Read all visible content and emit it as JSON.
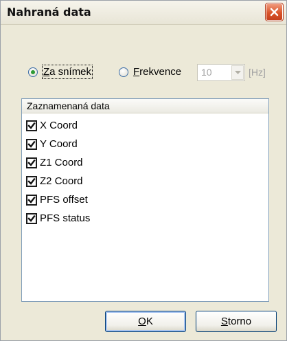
{
  "window": {
    "title": "Nahraná data"
  },
  "mode": {
    "per_frame_label_underlined": "Z",
    "per_frame_label_rest": "a snímek",
    "per_frame_selected": true,
    "frequency_label_underlined": "F",
    "frequency_label_rest": "rekvence",
    "frequency_selected": false,
    "frequency_value": "10",
    "frequency_unit": "[Hz]"
  },
  "list": {
    "header": "Zaznamenaná data",
    "items": [
      {
        "label": "X Coord",
        "checked": true
      },
      {
        "label": "Y Coord",
        "checked": true
      },
      {
        "label": "Z1 Coord",
        "checked": true
      },
      {
        "label": "Z2 Coord",
        "checked": true
      },
      {
        "label": "PFS offset",
        "checked": true
      },
      {
        "label": "PFS status",
        "checked": true
      }
    ]
  },
  "buttons": {
    "ok_underlined": "O",
    "ok_rest": "K",
    "cancel_underlined": "S",
    "cancel_rest": "torno"
  },
  "icons": {
    "close": "close-icon",
    "dropdown": "chevron-down-icon",
    "check": "checkmark-icon"
  },
  "colors": {
    "dialog_bg": "#ece9d8",
    "close_button": "#d9542a",
    "radio_selected_dot": "#2f9a35",
    "list_border": "#7f9db9",
    "disabled_text": "#a3a3a3",
    "button_border": "#003c74"
  }
}
